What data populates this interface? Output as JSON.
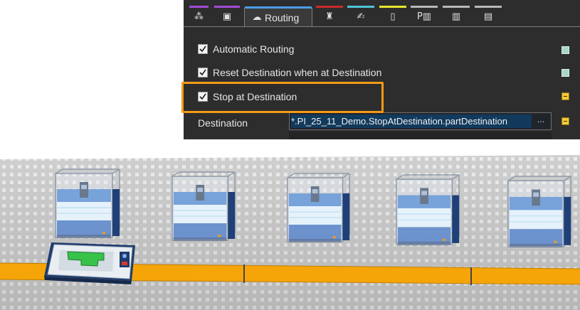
{
  "panel": {
    "tabs": [
      {
        "icon": "tree-icon",
        "color": "#a24bd6",
        "glyph": "⁂"
      },
      {
        "icon": "box-icon",
        "color": "#a24bd6",
        "glyph": "▣"
      },
      {
        "icon": "routing-icon",
        "color": "#4c9ee8",
        "glyph": "☁",
        "label": "Routing",
        "active": true
      },
      {
        "icon": "beacon-icon",
        "color": "#cc2b2b",
        "glyph": "♜"
      },
      {
        "icon": "signature-icon",
        "color": "#4fc4d8",
        "glyph": "✍"
      },
      {
        "icon": "battery-icon",
        "color": "#e6e62e",
        "glyph": "▯"
      },
      {
        "icon": "p-chart-icon",
        "color": "#b8b8b8",
        "glyph": "P▥"
      },
      {
        "icon": "chart-icon",
        "color": "#b8b8b8",
        "glyph": "▥"
      },
      {
        "icon": "document-icon",
        "color": "#b8b8b8",
        "glyph": "▤"
      }
    ],
    "options": [
      {
        "label": "Automatic Routing",
        "checked": true,
        "status": "green"
      },
      {
        "label": "Reset Destination when at Destination",
        "checked": true,
        "status": "green"
      },
      {
        "label": "Stop at Destination",
        "checked": true,
        "status": "yellow"
      }
    ],
    "destination": {
      "label": "Destination",
      "value": "*.PI_25_11_Demo.StopAtDestination.partDestination",
      "button": "...",
      "status": "yellow"
    }
  },
  "colors": {
    "highlight": "#f39a17",
    "track": "#f5a507",
    "panel_bg": "#2d2d2d",
    "floor": "#d0d0d0"
  }
}
